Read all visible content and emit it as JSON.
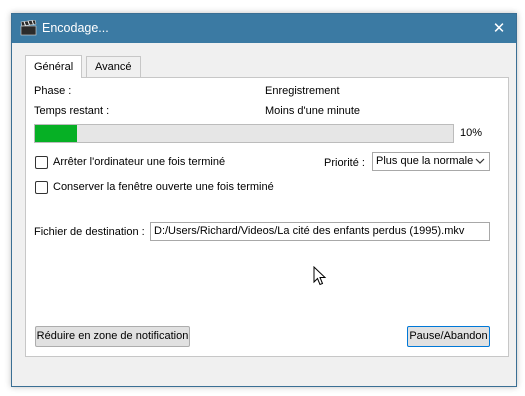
{
  "window": {
    "title": "Encodage...",
    "close_glyph": "✕"
  },
  "tabs": [
    {
      "label": "Général",
      "active": true
    },
    {
      "label": "Avancé",
      "active": false
    }
  ],
  "status": {
    "phase_label": "Phase :",
    "phase_value": "Enregistrement",
    "time_label": "Temps restant :",
    "time_value": "Moins d'une minute"
  },
  "progress": {
    "value": 0.1,
    "label": "10%",
    "color": "#06b025"
  },
  "options": {
    "shutdown_label": "Arrêter l'ordinateur une fois terminé",
    "shutdown_checked": false,
    "keep_open_label": "Conserver la fenêtre ouverte une fois terminé",
    "keep_open_checked": false,
    "priority_label": "Priorité :",
    "priority_value": "Plus que la normale"
  },
  "destination": {
    "label": "Fichier de destination :",
    "value": "D:/Users/Richard/Videos/La cité des enfants perdus (1995).mkv"
  },
  "buttons": {
    "minimize_tray": "Réduire en zone de notification",
    "pause_abort": "Pause/Abandon"
  },
  "icons": {
    "app": "clapperboard-icon",
    "close": "close-icon",
    "dropdown": "chevron-down-icon",
    "cursor": "mouse-cursor-icon"
  },
  "colors": {
    "titlebar": "#3b7aa3",
    "accent": "#0078d7"
  }
}
